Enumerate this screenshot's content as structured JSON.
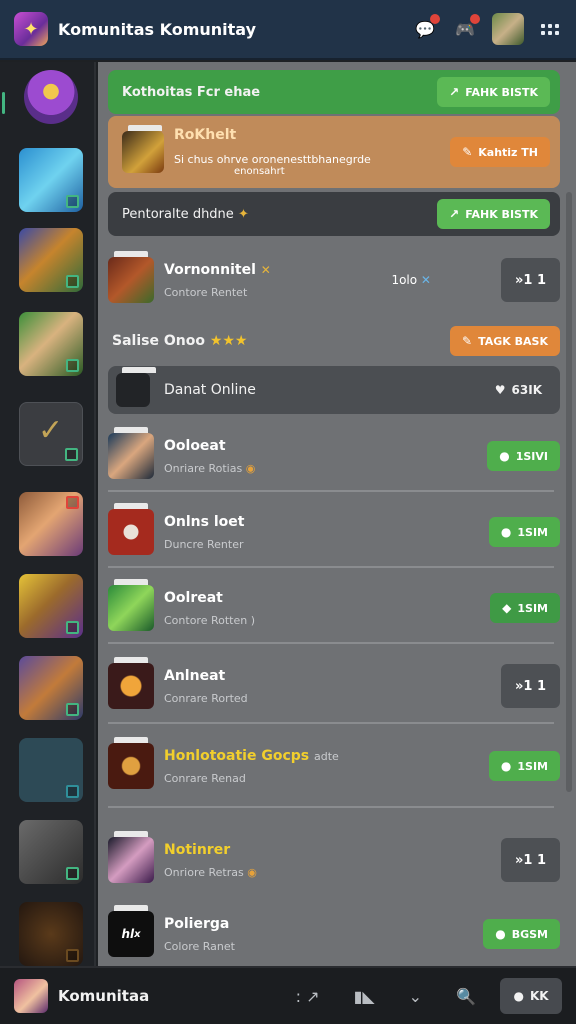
{
  "topbar": {
    "title": "Komunitas Komunitay",
    "icons": [
      "notification-icon",
      "discord-icon",
      "user-avatar",
      "grid-menu-icon"
    ]
  },
  "sidebar": {
    "items": [
      "server-avatar-1",
      "server-2",
      "server-3",
      "server-4",
      "check-server",
      "server-6",
      "server-7",
      "server-8",
      "server-9",
      "server-10",
      "server-11"
    ]
  },
  "banners": {
    "green": {
      "text": "Kothoitas Fcr ehae",
      "button": "FAHK BISTK"
    },
    "orange": {
      "title": "RoKhelt",
      "subtitle": "Si chus ohrve oronenesttbhanegrde",
      "subtitle2": "enonsahrt",
      "button": "Kahtiz TH"
    },
    "dark": {
      "text": "Pentoralte dhdne",
      "button": "FAHK BISTK"
    }
  },
  "section2": {
    "text": "Salise Onoo",
    "button": "TAGK BASK"
  },
  "online_row": {
    "text": "Danat Online",
    "button": "63IK"
  },
  "list": [
    {
      "title": "Vornonnitel",
      "subtitle": "Contore Rentet",
      "mid": "1olo",
      "button": "»1 1"
    },
    {
      "title": "Ooloeat",
      "subtitle": "Onriare Rotias",
      "button": "1SIVI"
    },
    {
      "title": "Onlns loet",
      "subtitle": "Duncre Renter",
      "button": "1SIM"
    },
    {
      "title": "Oolreat",
      "subtitle": "Contore Rotten )",
      "button": "1SIM"
    },
    {
      "title": "Anlneat",
      "subtitle": "Conrare Rorted",
      "button": "»1 1"
    },
    {
      "title": "Honlotoatie Gocps",
      "title_suffix": "adte",
      "subtitle": "Conrare Renad",
      "button": "1SIM"
    },
    {
      "title": "Notinrer",
      "subtitle": "Onriore Retras",
      "button": "»1 1"
    },
    {
      "title": "Polierga",
      "subtitle": "Colore Ranet",
      "button": "BGSM"
    }
  ],
  "bottombar": {
    "title": "Komunitaa",
    "button": "KK"
  },
  "colors": {
    "accent_green": "#4fae4c",
    "accent_orange": "#e0873a",
    "topbar_bg": "#213348"
  }
}
